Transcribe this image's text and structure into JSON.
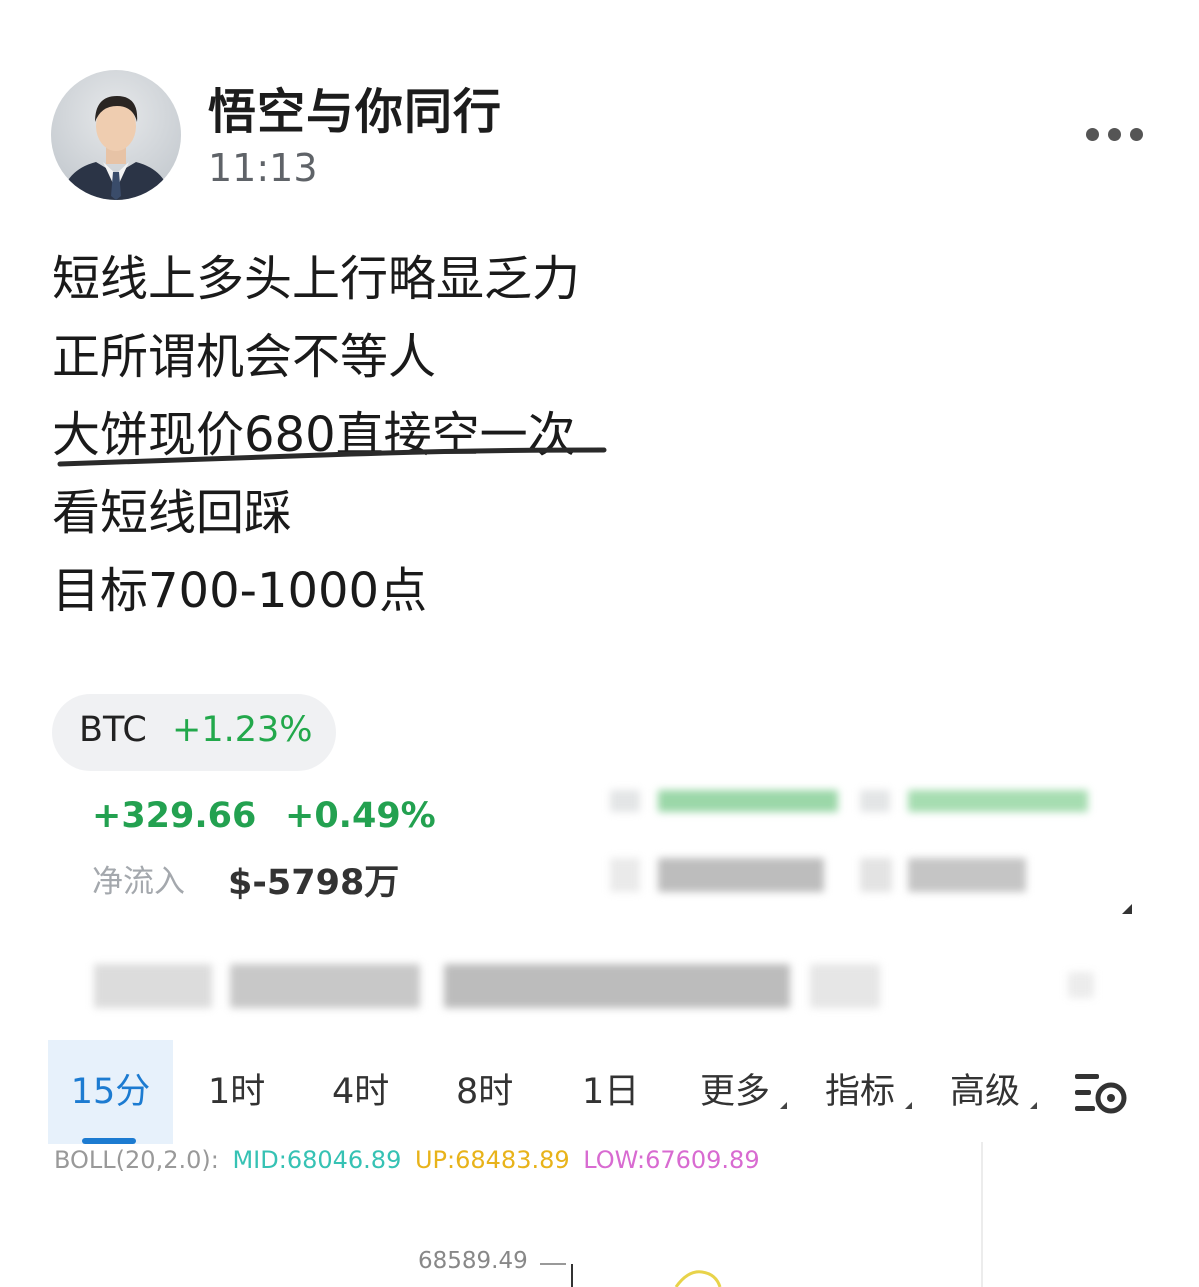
{
  "post": {
    "author": "悟空与你同行",
    "time": "11:13",
    "lines": [
      "短线上多头上行略显乏力",
      "正所谓机会不等人",
      "大饼现价680直接空一次",
      "看短线回踩",
      "目标700-1000点"
    ]
  },
  "ticker": {
    "symbol": "BTC",
    "change_pct": "+1.23%"
  },
  "stats": {
    "change": "+329.66",
    "change_pct": "+0.49%",
    "net_inflow_label": "净流入",
    "net_inflow_value": "$-5798万"
  },
  "tabs": [
    {
      "label": "15分",
      "active": true
    },
    {
      "label": "1时"
    },
    {
      "label": "4时"
    },
    {
      "label": "8时"
    },
    {
      "label": "1日"
    },
    {
      "label": "更多",
      "dropdown": true
    },
    {
      "label": "指标",
      "dropdown": true
    },
    {
      "label": "高级",
      "dropdown": true
    }
  ],
  "boll": {
    "label": "BOLL(20,2.0):",
    "mid": "MID:68046.89",
    "up": "UP:68483.89",
    "low": "LOW:67609.89"
  },
  "chart": {
    "price_tick": "68589.49"
  },
  "colors": {
    "up_green": "#23a150",
    "active_blue": "#1c7bd1",
    "mid": "#36c2b4",
    "up": "#e8b31a",
    "low": "#d86bd1"
  }
}
